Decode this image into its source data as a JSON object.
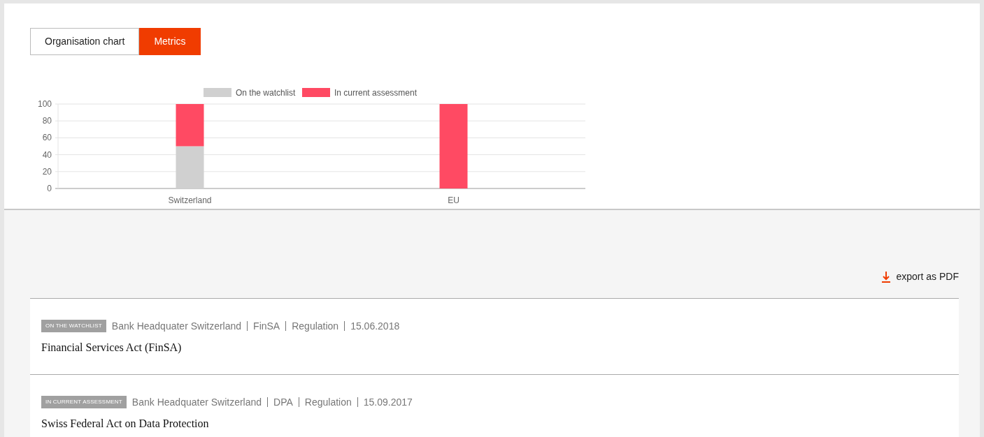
{
  "tabs": [
    {
      "label": "Organisation chart",
      "selected": false
    },
    {
      "label": "Metrics",
      "selected": true
    }
  ],
  "chart_data": {
    "type": "bar",
    "stacked": true,
    "grid": true,
    "legend": true,
    "categories": [
      "Switzerland",
      "EU"
    ],
    "ylim": [
      0,
      100
    ],
    "yticks": [
      0,
      20,
      40,
      60,
      80,
      100
    ],
    "series": [
      {
        "name": "On the watchlist",
        "color": "#d0d0d0",
        "values": [
          50,
          0
        ]
      },
      {
        "name": "In current assessment",
        "color": "#ff4a63",
        "values": [
          50,
          100
        ]
      }
    ]
  },
  "export": {
    "label": "export as PDF"
  },
  "items": [
    {
      "tag": "ON THE WATCHLIST",
      "meta": [
        "Bank Headquater Switzerland",
        "FinSA",
        "Regulation",
        "15.06.2018"
      ],
      "title": "Financial Services Act (FinSA)"
    },
    {
      "tag": "IN CURRENT ASSESSMENT",
      "meta": [
        "Bank Headquater Switzerland",
        "DPA",
        "Regulation",
        "15.09.2017"
      ],
      "title": "Swiss Federal Act on Data Protection"
    }
  ]
}
